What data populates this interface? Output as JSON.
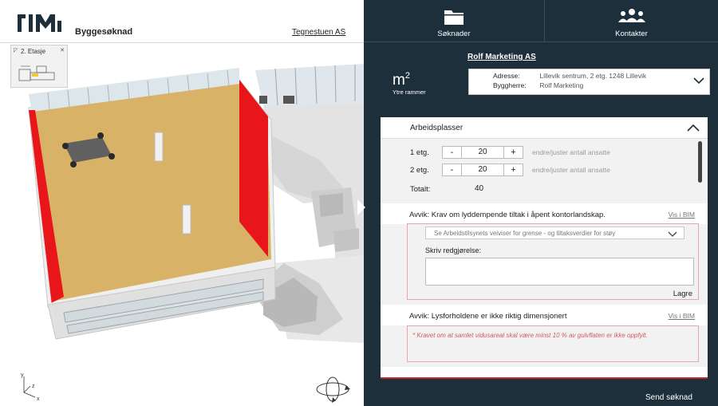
{
  "header": {
    "app_title": "Byggesøknad",
    "company": "Tegnestuen AS"
  },
  "viewer": {
    "floor_label": "2. Etasje",
    "axis": {
      "y": "y",
      "z": "z",
      "x": "x"
    }
  },
  "nav": {
    "tabs": [
      {
        "label": "Søknader",
        "icon": "folder-icon"
      },
      {
        "label": "Kontakter",
        "icon": "users-icon"
      }
    ]
  },
  "project": {
    "client": "Rolf Marketing AS",
    "brand_line1": "m",
    "brand_sup": "2",
    "brand_line2": "Ytre rammer",
    "address_label": "Adresse:",
    "address_value": "Lillevik sentrum, 2 etg. 1248 Lillevik",
    "owner_label": "Byggherre:",
    "owner_value": "Rolf Marketing"
  },
  "form": {
    "section_title": "Arbeidsplasser",
    "rows": [
      {
        "floor": "1 etg.",
        "minus": "-",
        "value": "20",
        "plus": "+",
        "hint": "endre/juster antall ansatte"
      },
      {
        "floor": "2 etg.",
        "minus": "-",
        "value": "20",
        "plus": "+",
        "hint": "endre/juster antall ansatte"
      }
    ],
    "total_label": "Totalt:",
    "total_value": "40",
    "deviation1": {
      "title": "Avvik: Krav om lyddempende tiltak i åpent kontorlandskap.",
      "link": "Vis i BIM",
      "select_text": "Se Arbeidstilsynets veiviser for grense - og tiltaksverdier for støy",
      "reason_label": "Skriv redgjørelse:",
      "reason_value": "",
      "save": "Lagre"
    },
    "deviation2": {
      "title": "Avvik: Lysforholdene er ikke riktig dimensjonert",
      "link": "Vis i BIM",
      "message": "* Kravet om at samlet vidusareal skal være minst 10 % av gulvflaten er ikke oppfylt."
    },
    "send": "Send søknad"
  },
  "colors": {
    "panel_bg": "#1d2f3b",
    "accent_red": "#c8262f",
    "floor": "#d8b266",
    "wall_red": "#e8161a",
    "warning_text": "#d35a5a"
  }
}
